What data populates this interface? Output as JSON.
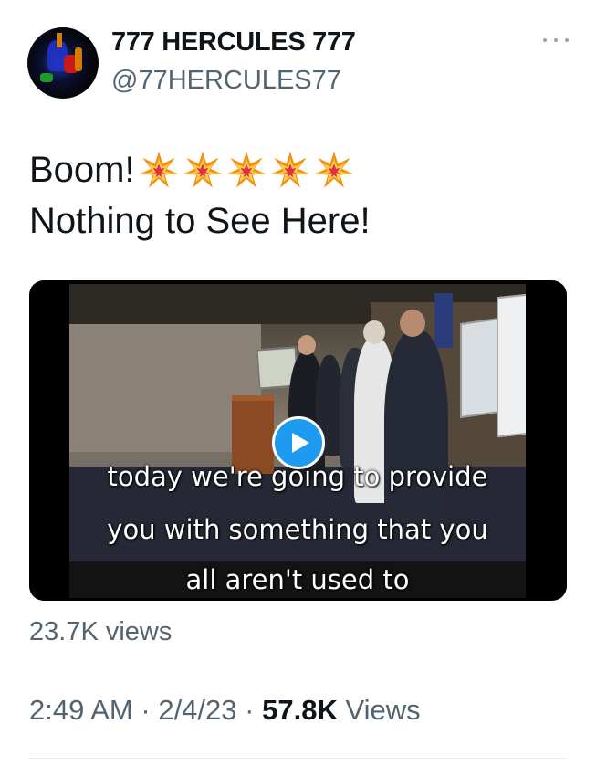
{
  "author": {
    "display_name": "777 HERCULES 777",
    "handle": "@77HERCULES77",
    "avatar_icon": "avatar-image"
  },
  "header": {
    "more_icon": "more-horizontal-icon"
  },
  "tweet": {
    "text_line1": "Boom!",
    "text_line2": "Nothing to See Here!",
    "emoji_icon": "collision-emoji",
    "emoji_count": 5
  },
  "media": {
    "type": "video",
    "play_icon": "play-icon",
    "captions": [
      "today we're going to provide",
      "you with something that you",
      "all aren't used to"
    ],
    "views_label": "23.7K views"
  },
  "meta": {
    "time": "2:49 AM",
    "separator": "·",
    "date": "2/4/23",
    "views_count": "57.8K",
    "views_label": "Views"
  },
  "colors": {
    "accent": "#1d9bf0",
    "secondary_text": "#536471",
    "primary_text": "#0f1419"
  }
}
